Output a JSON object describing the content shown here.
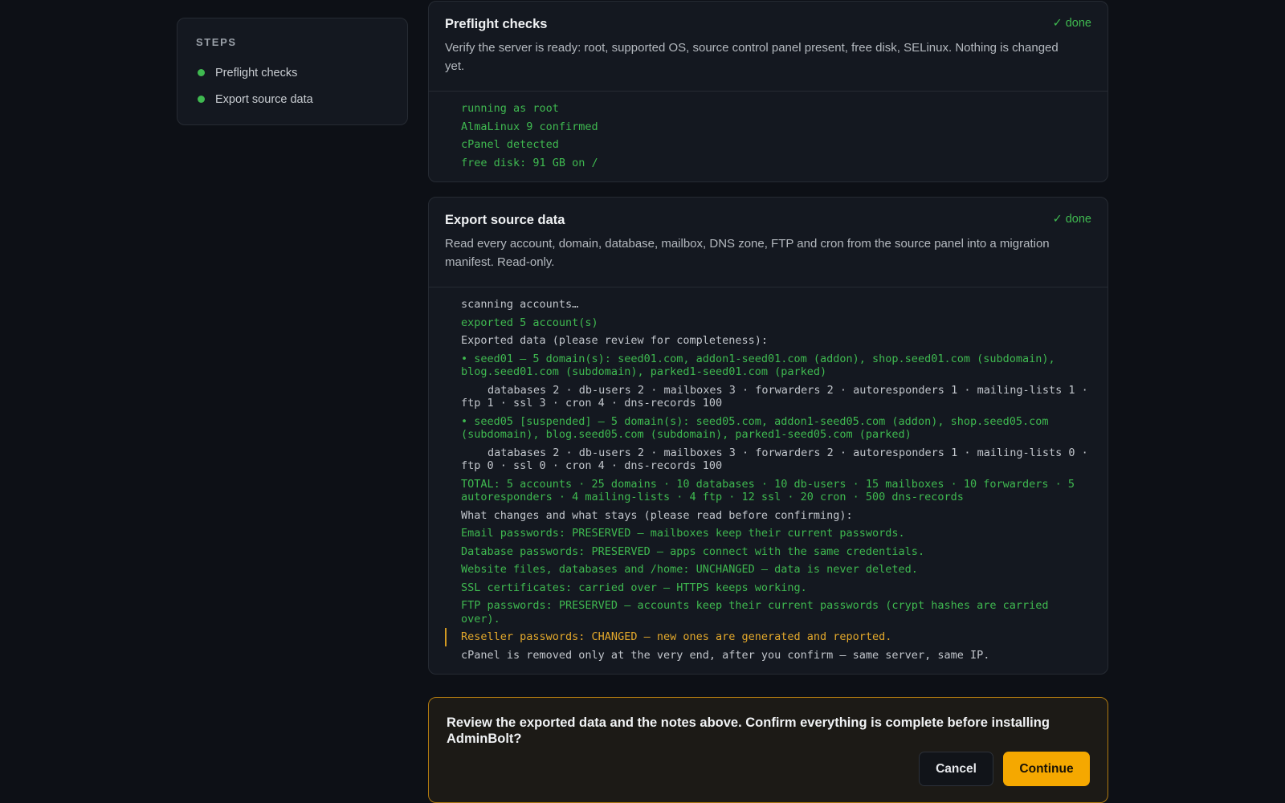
{
  "sidebar": {
    "title": "STEPS",
    "steps": [
      {
        "label": "Preflight checks"
      },
      {
        "label": "Export source data"
      }
    ]
  },
  "preflight": {
    "title": "Preflight checks",
    "status": "✓ done",
    "description": "Verify the server is ready: root, supported OS, source control panel present, free disk, SELinux. Nothing is changed yet.",
    "log": [
      "running as root",
      "AlmaLinux 9 confirmed",
      "cPanel detected",
      "free disk: 91 GB on /"
    ]
  },
  "export": {
    "title": "Export source data",
    "status": "✓ done",
    "description": "Read every account, domain, database, mailbox, DNS zone, FTP and cron from the source panel into a migration manifest. Read-only.",
    "log": [
      "scanning accounts…",
      "exported 5 account(s)",
      "Exported data (please review for completeness):",
      "• seed01 — 5 domain(s): seed01.com, addon1-seed01.com (addon), shop.seed01.com (subdomain), blog.seed01.com (subdomain), parked1-seed01.com (parked)",
      "databases 2 · db-users 2 · mailboxes 3 · forwarders 2 · autoresponders 1 · mailing-lists 1 · ftp 1 · ssl 3 · cron 4 · dns-records 100",
      "• seed05 [suspended] — 5 domain(s): seed05.com, addon1-seed05.com (addon), shop.seed05.com (subdomain), blog.seed05.com (subdomain), parked1-seed05.com (parked)",
      "databases 2 · db-users 2 · mailboxes 3 · forwarders 2 · autoresponders 1 · mailing-lists 0 · ftp 0 · ssl 0 · cron 4 · dns-records 100",
      "TOTAL: 5 accounts · 25 domains · 10 databases · 10 db-users · 15 mailboxes · 10 forwarders · 5 autoresponders · 4 mailing-lists · 4 ftp · 12 ssl · 20 cron · 500 dns-records",
      "What changes and what stays (please read before confirming):",
      "Email passwords: PRESERVED — mailboxes keep their current passwords.",
      "Database passwords: PRESERVED — apps connect with the same credentials.",
      "Website files, databases and /home: UNCHANGED — data is never deleted.",
      "SSL certificates: carried over — HTTPS keeps working.",
      "FTP passwords: PRESERVED — accounts keep their current passwords (crypt hashes are carried over).",
      "Reseller passwords: CHANGED — new ones are generated and reported.",
      "cPanel is removed only at the very end, after you confirm — same server, same IP."
    ]
  },
  "confirm": {
    "text": "Review the exported data and the notes above. Confirm everything is complete before installing AdminBolt?",
    "cancel_label": "Cancel",
    "continue_label": "Continue"
  },
  "colors": {
    "success": "#3fb950",
    "warning": "#e3a82b",
    "accent": "#f5a800",
    "background": "#0d1016"
  }
}
